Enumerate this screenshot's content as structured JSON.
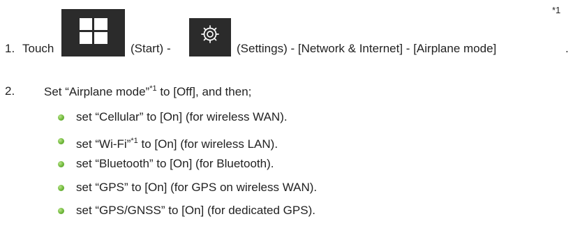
{
  "footnote_marker": "*1",
  "step1": {
    "number": "1.",
    "touch": "Touch",
    "start": "(Start) -",
    "settings_path": "(Settings) - [Network & Internet] - [Airplane mode]",
    "trailing": ".",
    "icons": [
      "windows-start-icon",
      "settings-gear-icon"
    ]
  },
  "step2": {
    "number": "2.",
    "text_a": "Set “Airplane mode”",
    "sup": "*1",
    "text_b": " to [Off], and then;"
  },
  "bullets": [
    {
      "text": "set “Cellular” to [On] (for wireless WAN)."
    },
    {
      "text_a": "set “Wi-Fi”",
      "sup": "*1",
      "text_b": " to [On] (for wireless LAN)."
    },
    {
      "text": "set “Bluetooth” to [On] (for Bluetooth)."
    },
    {
      "text": "set “GPS” to [On] (for GPS on wireless WAN)."
    },
    {
      "text": "set “GPS/GNSS” to [On] (for dedicated GPS)."
    }
  ],
  "colors": {
    "bullet": "#6fb83a",
    "tile": "#2b2b2b"
  }
}
